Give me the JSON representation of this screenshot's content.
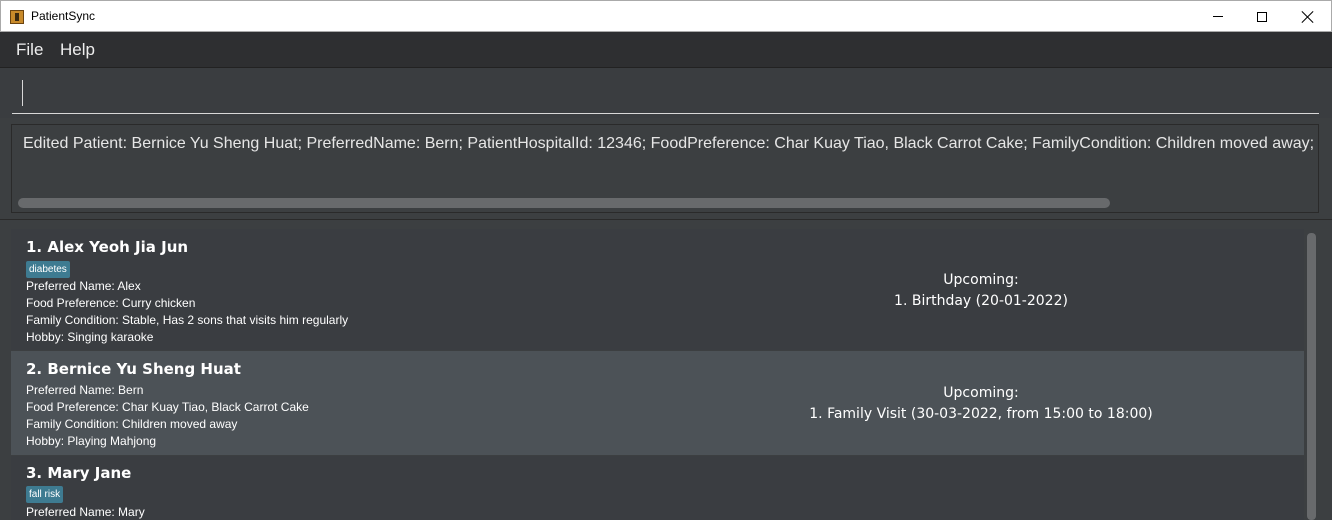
{
  "window": {
    "title": "PatientSync",
    "icon": "app-icon",
    "controls": [
      "minimize-icon",
      "maximize-icon",
      "close-icon"
    ]
  },
  "menu": {
    "items": [
      {
        "label": "File"
      },
      {
        "label": "Help"
      }
    ]
  },
  "command": {
    "value": "",
    "placeholder": ""
  },
  "result": {
    "text": "Edited Patient: Bernice Yu Sheng Huat; PreferredName: Bern; PatientHospitalId: 12346; FoodPreference: Char Kuay Tiao, Black Carrot Cake; FamilyCondition: Children moved away;"
  },
  "patients": [
    {
      "name": "1.  Alex Yeoh Jia Jun",
      "tag": "diabetes",
      "preferred_name": "Preferred Name: Alex",
      "food_preference": "Food Preference: Curry chicken",
      "family_condition": "Family Condition: Stable, Has 2 sons that visits him regularly",
      "hobby": "Hobby: Singing karaoke",
      "upcoming_title": "Upcoming:",
      "upcoming_event": "1. Birthday (20-01-2022)"
    },
    {
      "name": "2.  Bernice Yu Sheng Huat",
      "preferred_name": "Preferred Name: Bern",
      "food_preference": "Food Preference: Char Kuay Tiao, Black Carrot Cake",
      "family_condition": "Family Condition: Children moved away",
      "hobby": "Hobby: Playing Mahjong",
      "upcoming_title": "Upcoming:",
      "upcoming_event": "1. Family Visit (30-03-2022, from 15:00 to 18:00)"
    },
    {
      "name": "3.  Mary Jane",
      "tag": "fall risk",
      "preferred_name": "Preferred Name: Mary"
    }
  ],
  "colors": {
    "background": "#3c3f41",
    "selected_card": "#4c5257",
    "tag": "#3e7b91",
    "menubar": "#2e2f31"
  }
}
